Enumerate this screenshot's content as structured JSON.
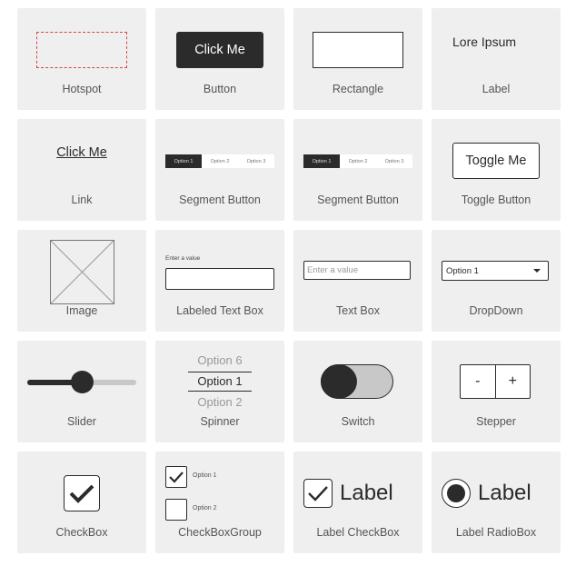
{
  "components": {
    "hotspot": {
      "caption": "Hotspot",
      "accent_color": "#d64545"
    },
    "button": {
      "caption": "Button",
      "label": "Click Me"
    },
    "rectangle": {
      "caption": "Rectangle"
    },
    "label": {
      "caption": "Label",
      "text": "Lore Ipsum"
    },
    "link": {
      "caption": "Link",
      "text": "Click Me"
    },
    "segment_button_1": {
      "caption": "Segment Button",
      "options": [
        "Option 1",
        "Option 2",
        "Option 3"
      ],
      "selected": "Option 1"
    },
    "segment_button_2": {
      "caption": "Segment Button",
      "options": [
        "Option 1",
        "Option 2",
        "Option 3"
      ],
      "selected": "Option 1"
    },
    "toggle_button": {
      "caption": "Toggle Button",
      "label": "Toggle Me"
    },
    "image": {
      "caption": "Image",
      "icon": "image-placeholder-icon"
    },
    "labeled_text_box": {
      "caption": "Labeled Text Box",
      "label": "Enter a value",
      "value": ""
    },
    "text_box": {
      "caption": "Text Box",
      "placeholder": "Enter a value",
      "value": ""
    },
    "dropdown": {
      "caption": "DropDown",
      "selected": "Option 1",
      "icon": "caret-down-icon"
    },
    "slider": {
      "caption": "Slider",
      "value_fraction": 0.5
    },
    "spinner": {
      "caption": "Spinner",
      "previous": "Option 6",
      "selected": "Option 1",
      "next": "Option 2"
    },
    "switch": {
      "caption": "Switch",
      "on": false
    },
    "stepper": {
      "caption": "Stepper",
      "decrement": "-",
      "increment": "+"
    },
    "checkbox": {
      "caption": "CheckBox",
      "checked": true,
      "icon": "checkmark-icon"
    },
    "checkbox_group": {
      "caption": "CheckBoxGroup",
      "items": [
        {
          "label": "Option 1",
          "checked": true
        },
        {
          "label": "Option 2",
          "checked": false
        }
      ]
    },
    "label_checkbox": {
      "caption": "Label CheckBox",
      "label": "Label",
      "checked": true
    },
    "label_radiobox": {
      "caption": "Label RadioBox",
      "label": "Label",
      "selected": true
    }
  }
}
